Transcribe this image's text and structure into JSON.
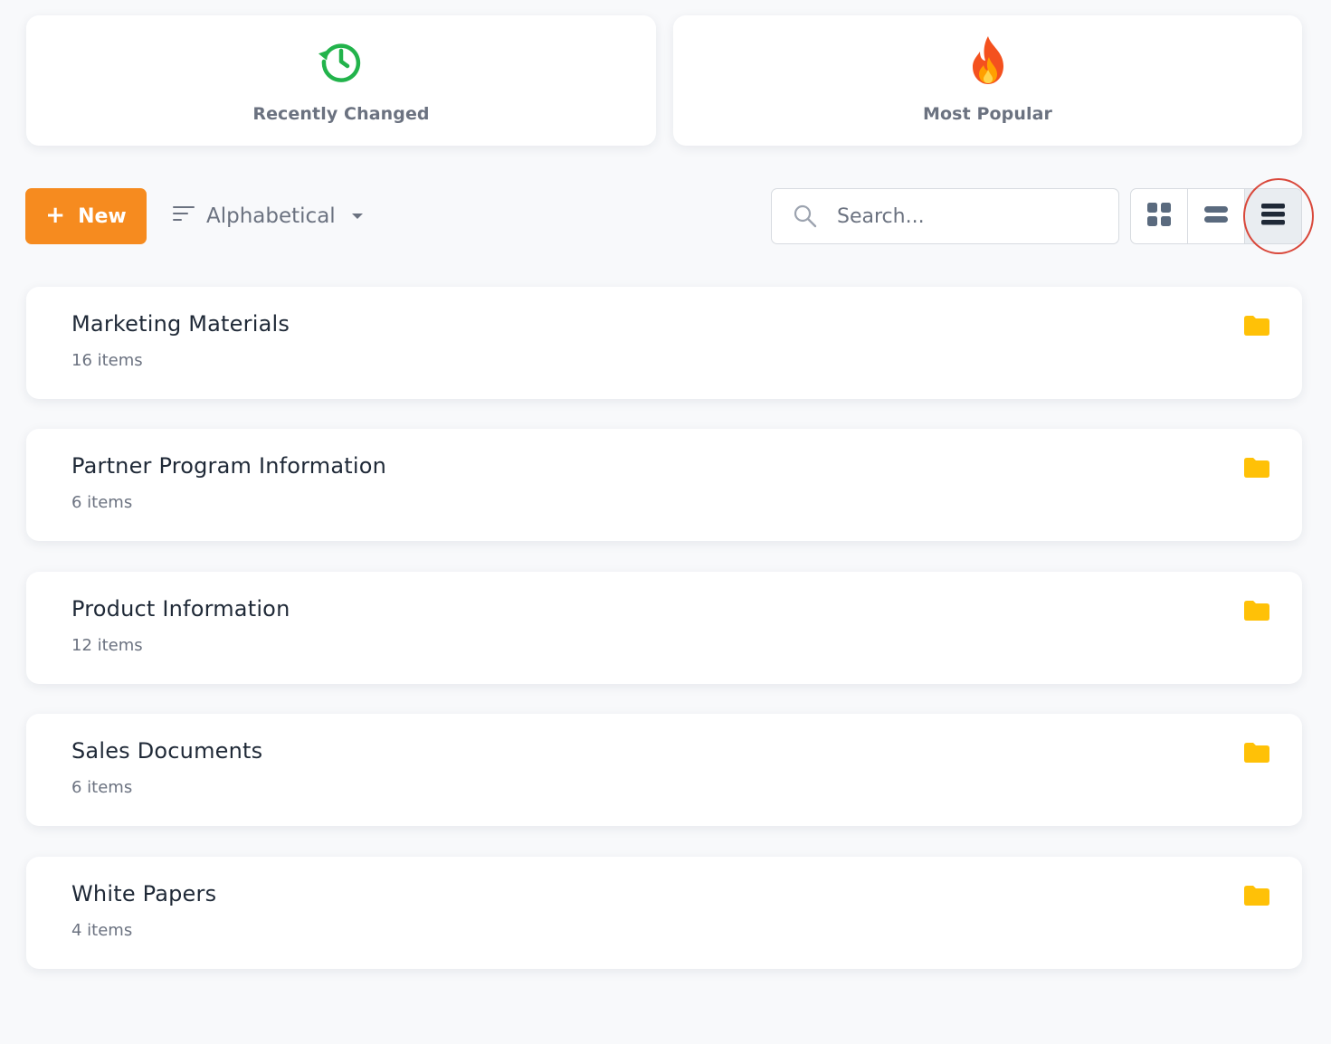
{
  "quick_access": {
    "recent_label": "Recently Changed",
    "popular_label": "Most Popular"
  },
  "toolbar": {
    "new_label": "New",
    "sort_label": "Alphabetical",
    "search_placeholder": "Search...",
    "views": [
      "grid-view",
      "compact-list-view",
      "list-view"
    ],
    "active_view": "list-view"
  },
  "folders": [
    {
      "name": "Marketing Materials",
      "count": "16 items"
    },
    {
      "name": "Partner Program Information",
      "count": "6 items"
    },
    {
      "name": "Product Information",
      "count": "12 items"
    },
    {
      "name": "Sales Documents",
      "count": "6 items"
    },
    {
      "name": "White Papers",
      "count": "4 items"
    }
  ],
  "colors": {
    "accent": "#f68b1f",
    "folder": "#ffc107",
    "recent_icon": "#22b34b",
    "highlight": "#d9483b"
  }
}
